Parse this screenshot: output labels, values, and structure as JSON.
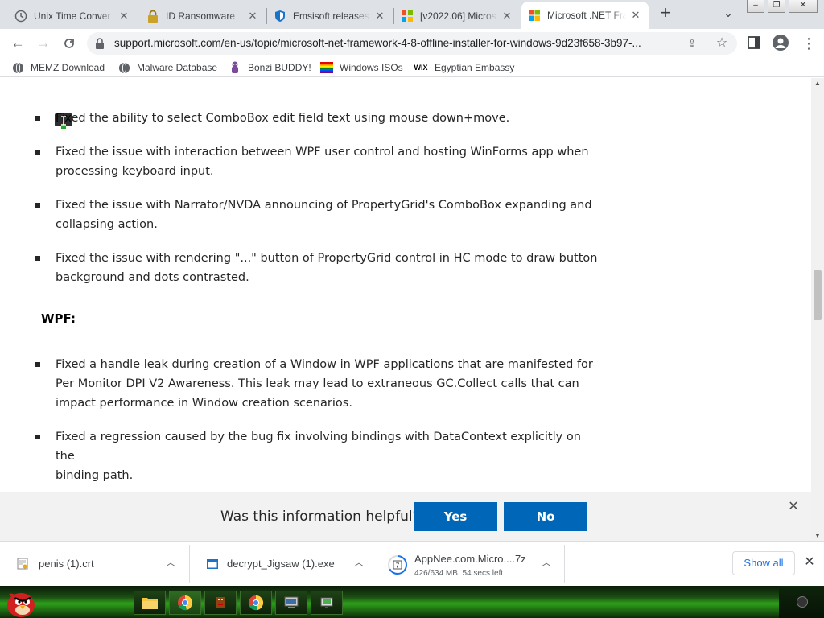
{
  "tabs": [
    {
      "title": "Unix Time Conver",
      "icon": "clock-icon"
    },
    {
      "title": "ID Ransomware",
      "icon": "lock-icon"
    },
    {
      "title": "Emsisoft releases",
      "icon": "shield-icon"
    },
    {
      "title": "[v2022.06] Micros",
      "icon": "windows-logo-icon"
    },
    {
      "title": "Microsoft .NET Fra",
      "icon": "microsoft-logo-icon",
      "active": true
    }
  ],
  "toolbar": {
    "url": "support.microsoft.com/en-us/topic/microsoft-net-framework-4-8-offline-installer-for-windows-9d23f658-3b97-..."
  },
  "bookmarks": [
    {
      "label": "MEMZ Download",
      "icon": "globe-icon"
    },
    {
      "label": "Malware Database",
      "icon": "globe-icon"
    },
    {
      "label": "Bonzi BUDDY!",
      "icon": "bonzi-icon"
    },
    {
      "label": "Windows ISOs",
      "icon": "rainbow-flag-icon"
    },
    {
      "label": "Egyptian Embassy",
      "icon": "wix-icon"
    }
  ],
  "content": {
    "bullets_top": [
      [
        "Fixed the ability to select ComboBox edit field text using mouse down+move."
      ],
      [
        "Fixed the issue with interaction between WPF user control and hosting WinForms app when",
        "processing keyboard input."
      ],
      [
        "Fixed the issue with Narrator/NVDA announcing of PropertyGrid's ComboBox expanding and",
        "collapsing action."
      ],
      [
        "Fixed the issue with rendering \"...\" button of PropertyGrid control in HC mode to draw button",
        "background and dots contrasted."
      ]
    ],
    "section_heading": "WPF:",
    "bullets_wpf": [
      [
        "Fixed a handle leak during creation of a Window in WPF applications that are manifested for",
        "Per Monitor DPI V2 Awareness.  This leak may lead to extraneous GC.Collect calls that can",
        "impact performance in Window creation scenarios."
      ],
      [
        "Fixed a regression caused by the bug fix involving bindings with DataContext explicitly on the",
        "binding path."
      ]
    ]
  },
  "feedback": {
    "question": "Was this information helpful?",
    "yes": "Yes",
    "no": "No"
  },
  "downloads": [
    {
      "name": "penis (1).crt",
      "icon": "certificate-icon"
    },
    {
      "name": "decrypt_Jigsaw (1).exe",
      "icon": "exe-icon"
    },
    {
      "name": "AppNee.com.Micro....7z",
      "status": "426/634 MB, 54 secs left",
      "icon": "7zip-icon"
    }
  ],
  "download_shelf": {
    "show_all": "Show all"
  },
  "colors": {
    "ms_blue": "#0067b8",
    "taskbar_green": "#2da01a"
  }
}
